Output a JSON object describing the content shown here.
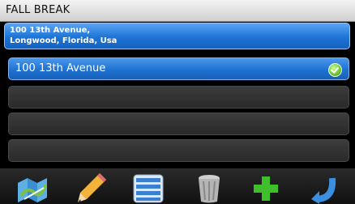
{
  "title": "FALL BREAK",
  "address": {
    "line1": "100 13th Avenue,",
    "line2": "Longwood, Florida, Usa"
  },
  "list": {
    "items": [
      {
        "label": "100 13th Avenue",
        "selected": true,
        "icon": "check-icon"
      },
      {
        "label": "",
        "selected": false
      },
      {
        "label": "",
        "selected": false
      },
      {
        "label": "",
        "selected": false
      }
    ]
  },
  "toolbar": {
    "buttons": [
      "map-icon",
      "pencil-icon",
      "list-icon",
      "trash-icon",
      "add-icon",
      "back-icon"
    ]
  },
  "colors": {
    "accent": "#1d74d6",
    "check": "#5cb81e",
    "add": "#3fbf2a"
  }
}
